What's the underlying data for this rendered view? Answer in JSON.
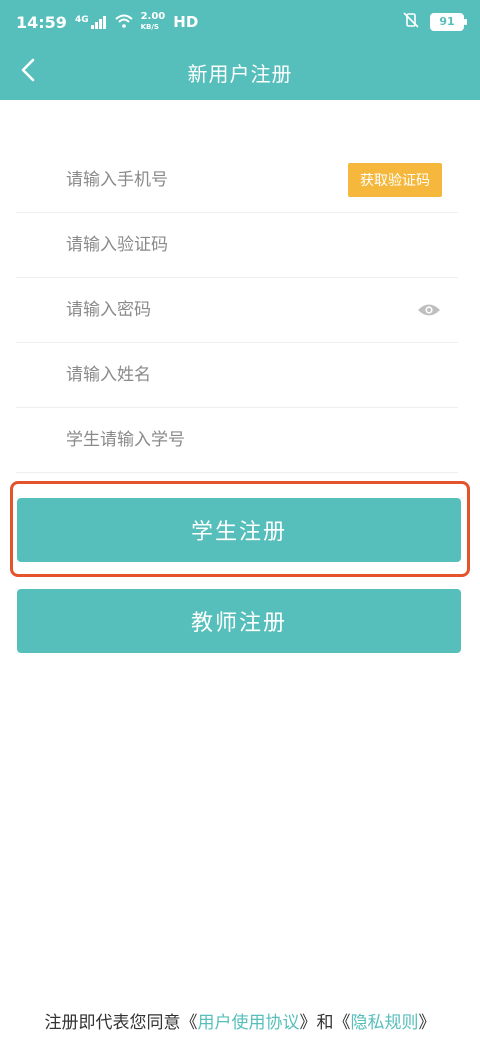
{
  "status_bar": {
    "time": "14:59",
    "network": "4G",
    "speed_value": "2.00",
    "speed_unit": "KB/S",
    "hd": "HD",
    "battery": "91"
  },
  "header": {
    "title": "新用户注册"
  },
  "form": {
    "phone_placeholder": "请输入手机号",
    "get_code_label": "获取验证码",
    "code_placeholder": "请输入验证码",
    "password_placeholder": "请输入密码",
    "name_placeholder": "请输入姓名",
    "student_id_placeholder": "学生请输入学号"
  },
  "buttons": {
    "student_register": "学生注册",
    "teacher_register": "教师注册"
  },
  "footer": {
    "prefix": "注册即代表您同意",
    "open1": "《",
    "user_agreement": "用户使用协议",
    "close1": "》",
    "and": "和",
    "open2": "《",
    "privacy_rules": "隐私规则",
    "close2": "》"
  },
  "colors": {
    "primary": "#56bfbb",
    "accent_button": "#f5b83d",
    "highlight": "#e5532c"
  },
  "icons": {
    "back": "chevron-left-icon",
    "eye": "eye-icon",
    "signal": "signal-icon",
    "wifi": "wifi-icon",
    "mute": "vibrate-off-icon"
  }
}
